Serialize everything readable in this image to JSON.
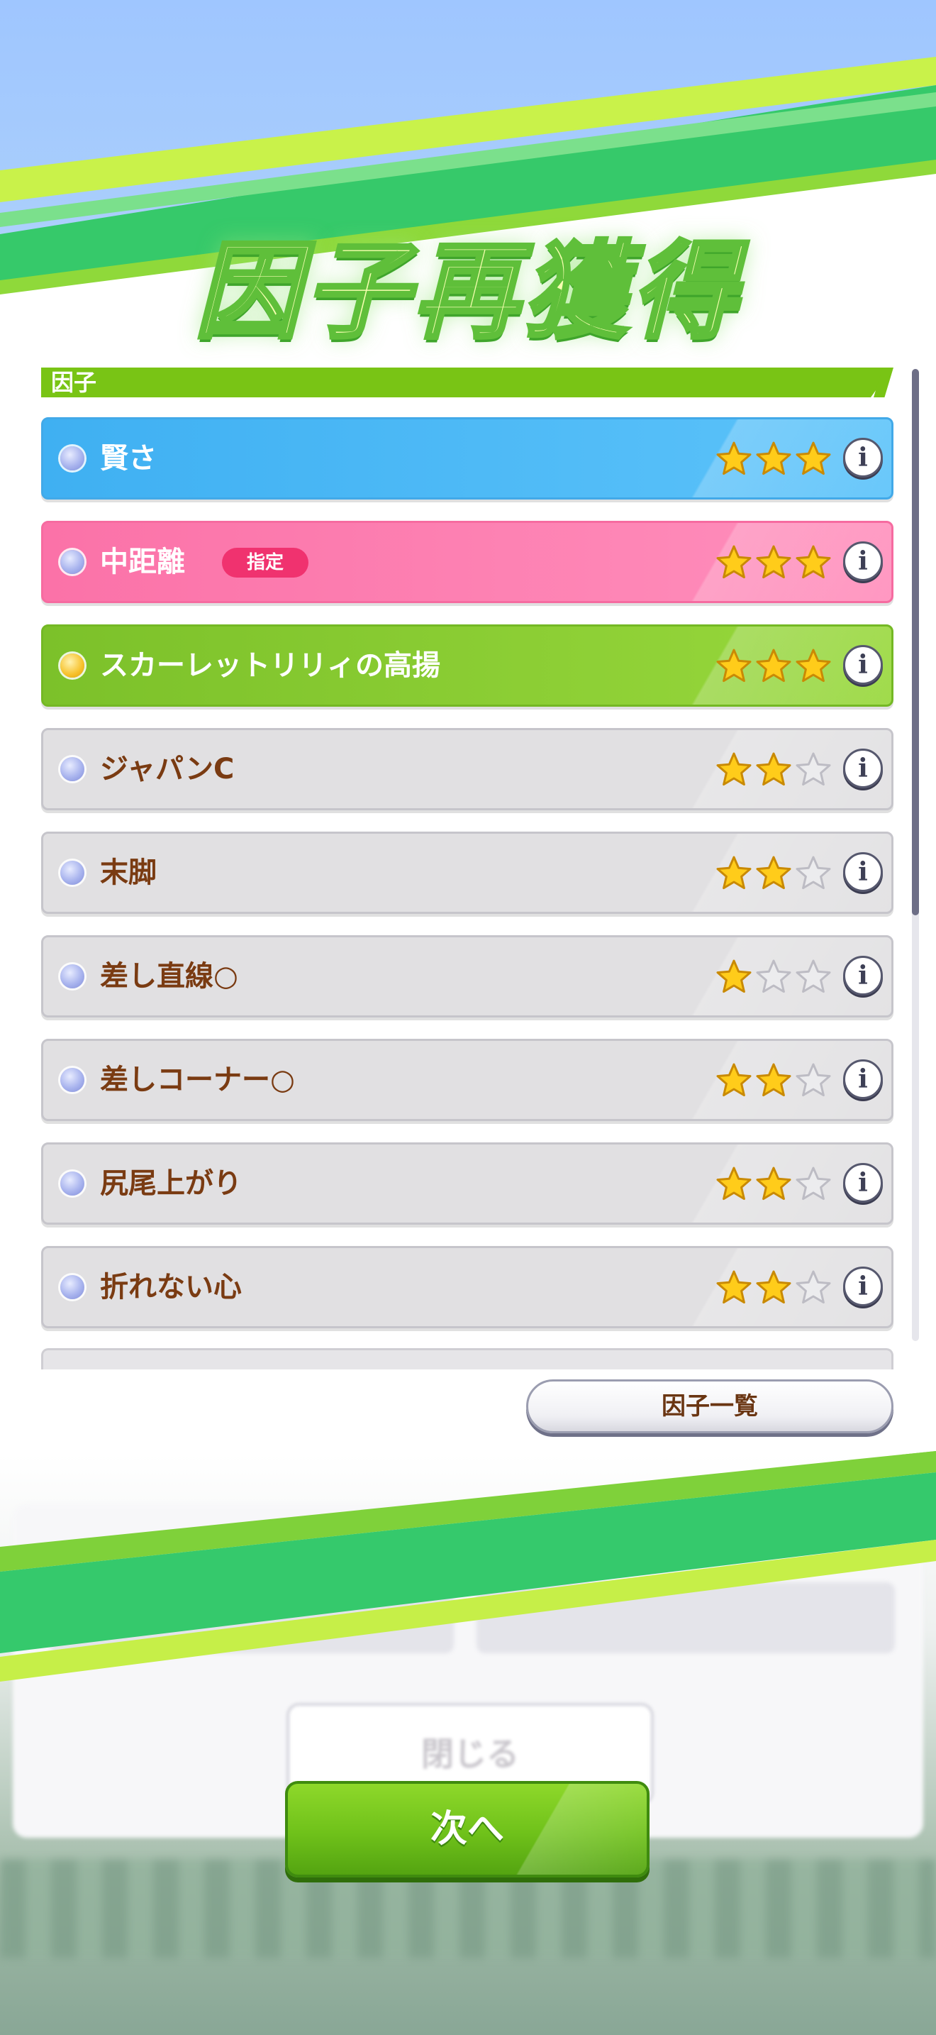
{
  "title": "因子再獲得",
  "section": {
    "label": "因子"
  },
  "factors": [
    {
      "name": "賢さ",
      "badge": "",
      "stars": 3,
      "color": "blue",
      "dot": "silver"
    },
    {
      "name": "中距離",
      "badge": "指定",
      "stars": 3,
      "color": "pink",
      "dot": "silver"
    },
    {
      "name": "スカーレットリリィの高揚",
      "badge": "",
      "stars": 3,
      "color": "green",
      "dot": "gold"
    },
    {
      "name": "ジャパンC",
      "badge": "",
      "stars": 2,
      "color": "gray",
      "dot": "silver"
    },
    {
      "name": "末脚",
      "badge": "",
      "stars": 2,
      "color": "gray",
      "dot": "silver"
    },
    {
      "name": "差し直線○",
      "badge": "",
      "stars": 1,
      "color": "gray",
      "dot": "silver"
    },
    {
      "name": "差しコーナー○",
      "badge": "",
      "stars": 2,
      "color": "gray",
      "dot": "silver"
    },
    {
      "name": "尻尾上がり",
      "badge": "",
      "stars": 2,
      "color": "gray",
      "dot": "silver"
    },
    {
      "name": "折れない心",
      "badge": "",
      "stars": 2,
      "color": "gray",
      "dot": "silver"
    }
  ],
  "buttons": {
    "factor_list": "因子一覧",
    "close": "閉じる",
    "next": "次へ"
  },
  "colors": {
    "accent_green": "#79c415",
    "blue_row": "#3fb0f2",
    "pink_row": "#fb72a8",
    "green_row": "#7cc12a",
    "gray_row": "#e1e0e2",
    "label_brown": "#7a3b12",
    "badge_red": "#f0326f"
  }
}
